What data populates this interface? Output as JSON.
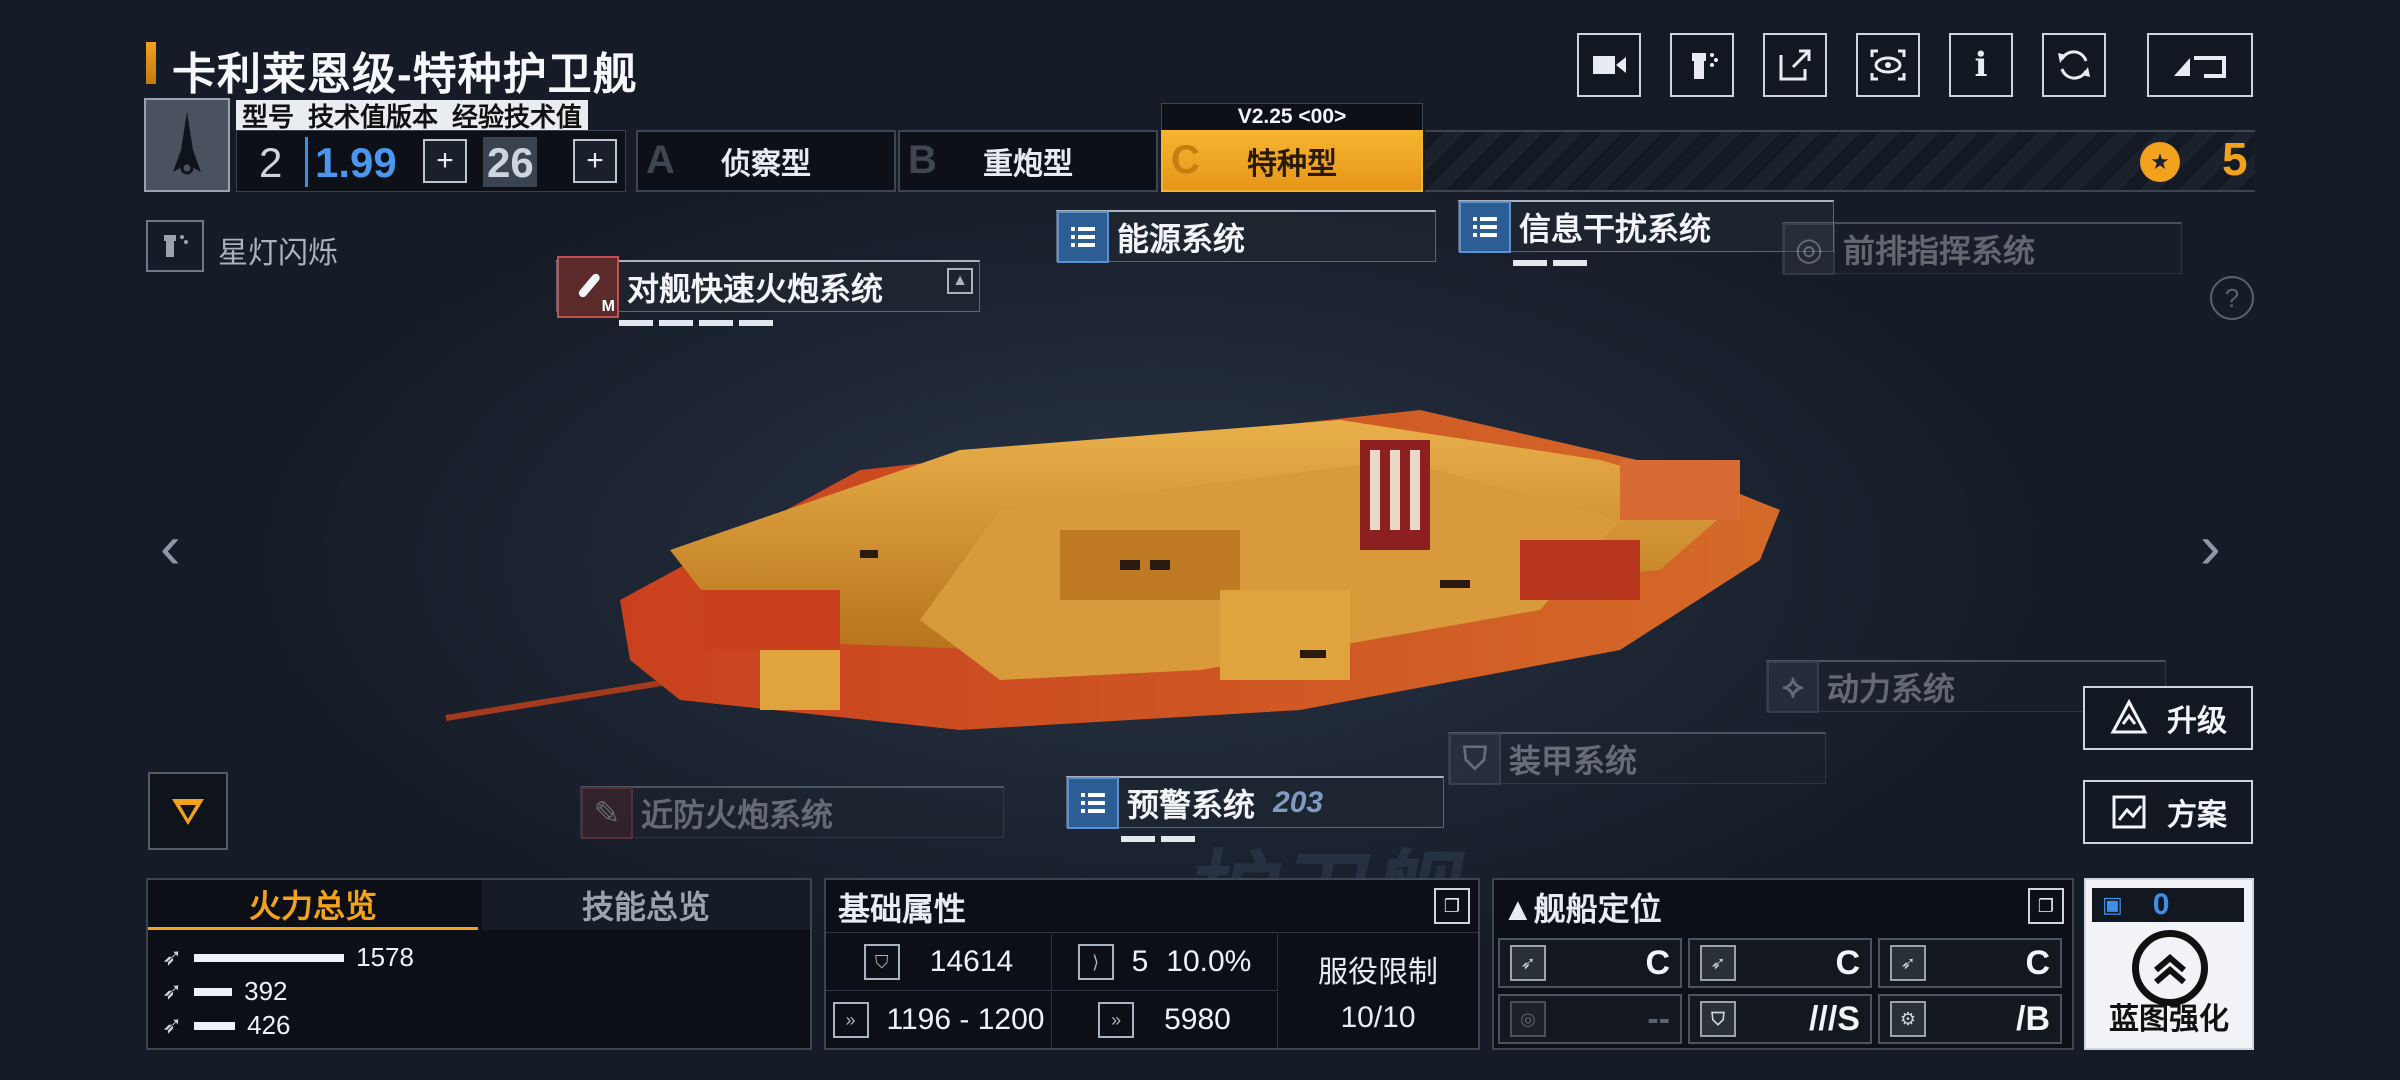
{
  "header": {
    "title": "卡利莱恩级-特种护卫舰",
    "icons": [
      "video-camera-icon",
      "paint-spray-icon",
      "share-icon",
      "eye-view-icon",
      "info-icon",
      "refresh-icon",
      "back-icon"
    ],
    "info_glyph": "i"
  },
  "ship_info": {
    "headers": [
      "型号",
      "技术值版本",
      "经验技术值"
    ],
    "model": "2",
    "tech_version": "1.99",
    "exp_value": "26",
    "plus_glyph": "+"
  },
  "variants": {
    "version": "V2.25 <00>",
    "tabs": [
      {
        "letter": "A",
        "label": "侦察型"
      },
      {
        "letter": "B",
        "label": "重炮型"
      },
      {
        "letter": "C",
        "label": "特种型"
      }
    ]
  },
  "rank": "5",
  "skin_name": "星灯闪烁",
  "systems": {
    "anti_ship": "对舰快速火炮系统",
    "anti_ship_badge": "M",
    "energy": "能源系统",
    "jamming": "信息干扰系统",
    "command": "前排指挥系统",
    "power": "动力系统",
    "armor": "装甲系统",
    "close_defense": "近防火炮系统",
    "warning": "预警系统",
    "warning_num": "203"
  },
  "nav": {
    "left": "‹",
    "right": "›",
    "help": "?"
  },
  "actions": {
    "upgrade": "升级",
    "plan": "方案"
  },
  "watermark": "护卫舰",
  "firepower": {
    "tabs": [
      "火力总览",
      "技能总览"
    ],
    "values": [
      "1578",
      "392",
      "426"
    ],
    "fraction": [
      1.0,
      0.25,
      0.27
    ]
  },
  "basic": {
    "title": "基础属性",
    "hp": "14614",
    "armor_val": "5",
    "armor_pct": "10.0%",
    "speed": "1196 - 1200",
    "warp": "5980",
    "service_label": "服役限制",
    "service_val": "10/10"
  },
  "role": {
    "title": "▲舰船定位",
    "cells": [
      "C",
      "C",
      "C",
      "--",
      "///S",
      "/B"
    ]
  },
  "blueprint": {
    "count": "0",
    "label": "蓝图强化"
  },
  "colors": {
    "accent": "#f2a21c",
    "blue": "#3f8ee8",
    "bg": "#1b2230"
  }
}
